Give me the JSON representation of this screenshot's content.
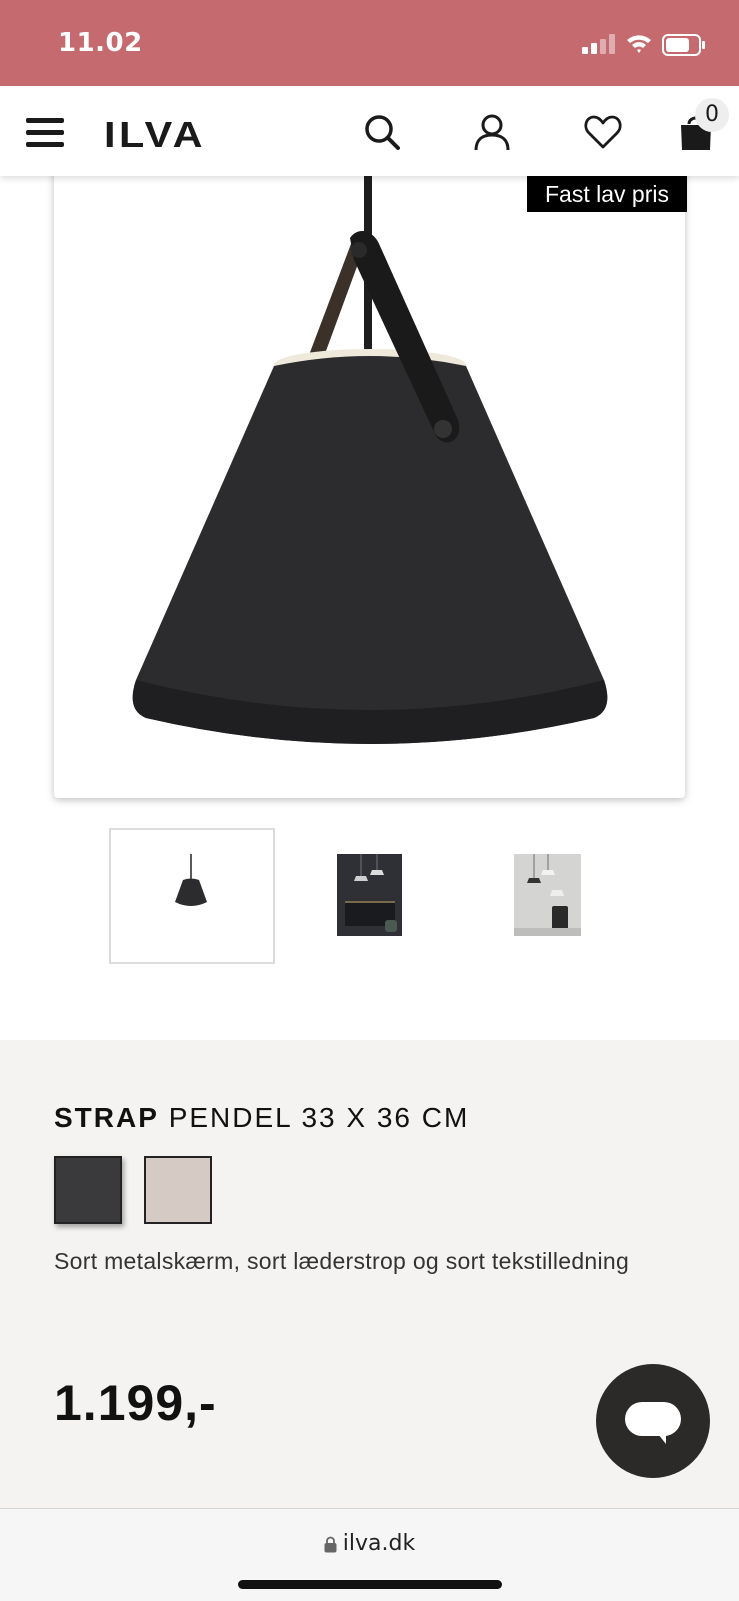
{
  "status_bar": {
    "time": "11.02",
    "icons": [
      "cellular-signal-icon",
      "wifi-icon",
      "battery-icon"
    ]
  },
  "header": {
    "logo": "ILVA",
    "icons": [
      "menu-icon",
      "search-icon",
      "account-icon",
      "heart-icon",
      "bag-icon"
    ],
    "cart_count": "0"
  },
  "product_image": {
    "badge": "Fast lav pris"
  },
  "thumbnails": [
    {
      "name": "thumbnail-product",
      "active": true
    },
    {
      "name": "thumbnail-room-dark",
      "active": false
    },
    {
      "name": "thumbnail-room-light",
      "active": false
    }
  ],
  "product": {
    "brand": "STRAP",
    "title": "PENDEL 33 X 36 CM",
    "variants": [
      {
        "label": "sort",
        "color": "#3a3a3c",
        "selected": true
      },
      {
        "label": "sand",
        "color": "#d6cac4",
        "selected": false
      }
    ],
    "description": "Sort metalskærm, sort læderstrop og sort tekstilledning",
    "price": "1.199,-"
  },
  "chat_button": {
    "icon": "chat-bubble-icon"
  },
  "browser": {
    "url": "ilva.dk"
  },
  "colors": {
    "status_bar": "#c56b6f",
    "info_background": "#f4f3f1",
    "chat_button": "#2b2a29"
  }
}
